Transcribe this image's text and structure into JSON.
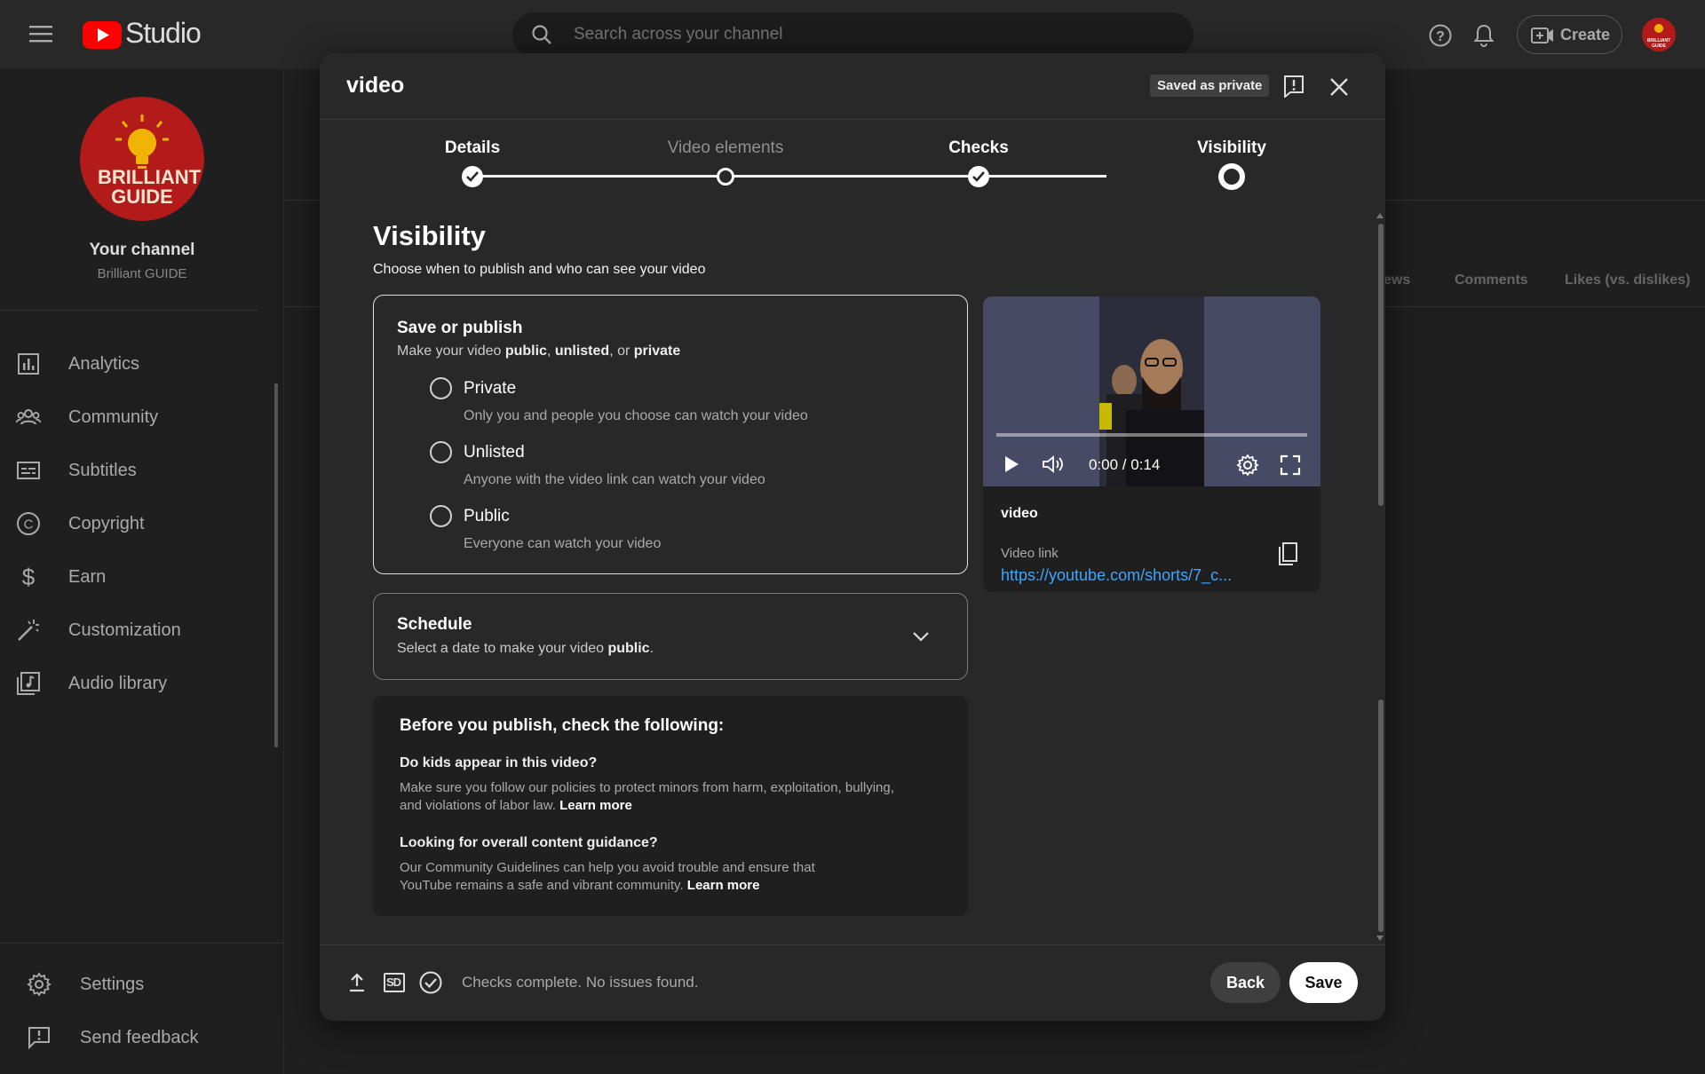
{
  "app": {
    "logo_text": "Studio",
    "search_placeholder": "Search across your channel",
    "create_label": "Create"
  },
  "sidebar": {
    "avatar_text": "BRILLIANT GUIDE",
    "channel_heading": "Your channel",
    "channel_name": "Brilliant GUIDE",
    "items": [
      {
        "label": "Analytics",
        "icon": "analytics-icon"
      },
      {
        "label": "Community",
        "icon": "community-icon"
      },
      {
        "label": "Subtitles",
        "icon": "subtitles-icon"
      },
      {
        "label": "Copyright",
        "icon": "copyright-icon"
      },
      {
        "label": "Earn",
        "icon": "dollar-icon"
      },
      {
        "label": "Customization",
        "icon": "magic-wand-icon"
      },
      {
        "label": "Audio library",
        "icon": "audio-library-icon"
      }
    ],
    "footer": [
      {
        "label": "Settings",
        "icon": "gear-icon"
      },
      {
        "label": "Send feedback",
        "icon": "feedback-icon"
      }
    ]
  },
  "background_table": {
    "columns": [
      "ews",
      "Comments",
      "Likes (vs. dislikes)"
    ]
  },
  "dialog": {
    "title": "video",
    "saved_badge": "Saved as private",
    "steps": [
      {
        "label": "Details",
        "state": "done"
      },
      {
        "label": "Video elements",
        "state": "todo"
      },
      {
        "label": "Checks",
        "state": "done"
      },
      {
        "label": "Visibility",
        "state": "current"
      }
    ],
    "section_title": "Visibility",
    "section_subtitle": "Choose when to publish and who can see your video",
    "save_publish": {
      "title": "Save or publish",
      "subtitle_prefix": "Make your video ",
      "opt_public": "public",
      "sep1": ", ",
      "opt_unlisted": "unlisted",
      "sep2": ", or ",
      "opt_private": "private",
      "options": [
        {
          "label": "Private",
          "desc": "Only you and people you choose can watch your video"
        },
        {
          "label": "Unlisted",
          "desc": "Anyone with the video link can watch your video"
        },
        {
          "label": "Public",
          "desc": "Everyone can watch your video"
        }
      ]
    },
    "schedule": {
      "title": "Schedule",
      "subtitle_prefix": "Select a date to make your video ",
      "subtitle_bold": "public",
      "subtitle_suffix": "."
    },
    "checklist": {
      "heading": "Before you publish, check the following:",
      "q1": "Do kids appear in this video?",
      "t1": "Make sure you follow our policies to protect minors from harm, exploitation, bullying, and violations of labor law.",
      "q2": "Looking for overall content guidance?",
      "t2": "Our Community Guidelines can help you avoid trouble and ensure that YouTube remains a safe and vibrant community.",
      "learn_more": "Learn more"
    },
    "video": {
      "time": "0:00 / 0:14",
      "name": "video",
      "link_label": "Video link",
      "link": "https://youtube.com/shorts/7_c..."
    },
    "footer": {
      "status": "Checks complete. No issues found.",
      "sd_badge": "SD",
      "back_label": "Back",
      "save_label": "Save"
    }
  },
  "colors": {
    "accent_red": "#ff0000",
    "link_blue": "#3ea6ff",
    "avatar_red": "#b31b1b"
  }
}
